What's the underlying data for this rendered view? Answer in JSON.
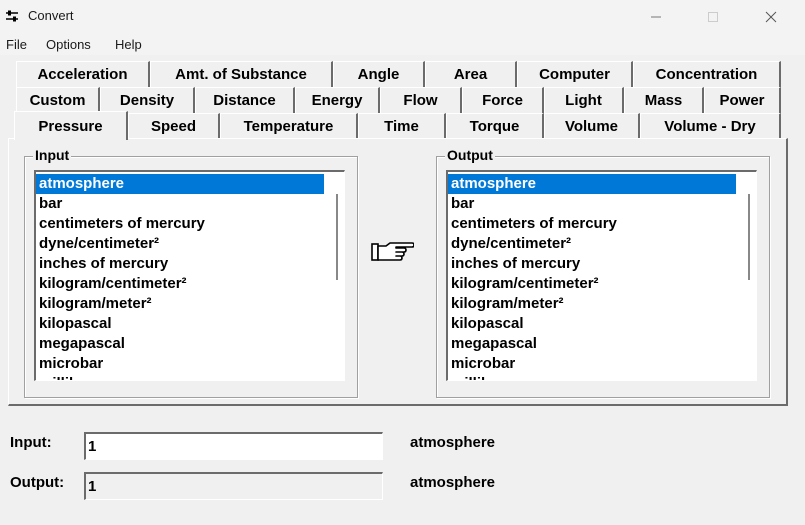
{
  "window": {
    "title": "Convert",
    "icon": "sliders-icon"
  },
  "menu": {
    "file": "File",
    "options": "Options",
    "help": "Help"
  },
  "tabs": {
    "row1": [
      "Acceleration",
      "Amt. of Substance",
      "Angle",
      "Area",
      "Computer",
      "Concentration"
    ],
    "row2": [
      "Custom",
      "Density",
      "Distance",
      "Energy",
      "Flow",
      "Force",
      "Light",
      "Mass",
      "Power"
    ],
    "row3": [
      "Pressure",
      "Speed",
      "Temperature",
      "Time",
      "Torque",
      "Volume",
      "Volume - Dry"
    ],
    "active": "Pressure"
  },
  "input_group": {
    "label": "Input",
    "items": [
      "atmosphere",
      "bar",
      "centimeters of mercury",
      "dyne/centimeter²",
      "inches of mercury",
      "kilogram/centimeter²",
      "kilogram/meter²",
      "kilopascal",
      "megapascal",
      "microbar",
      "millibar"
    ],
    "selected": "atmosphere"
  },
  "output_group": {
    "label": "Output",
    "items": [
      "atmosphere",
      "bar",
      "centimeters of mercury",
      "dyne/centimeter²",
      "inches of mercury",
      "kilogram/centimeter²",
      "kilogram/meter²",
      "kilopascal",
      "megapascal",
      "microbar",
      "millibar"
    ],
    "selected": "atmosphere"
  },
  "convert_icon": "pointing-hand-icon",
  "input_field": {
    "label": "Input:",
    "value": "1",
    "unit": "atmosphere"
  },
  "output_field": {
    "label": "Output:",
    "value": "1",
    "unit": "atmosphere"
  },
  "colors": {
    "selection": "#0078d7",
    "background": "#f0f0f0"
  }
}
